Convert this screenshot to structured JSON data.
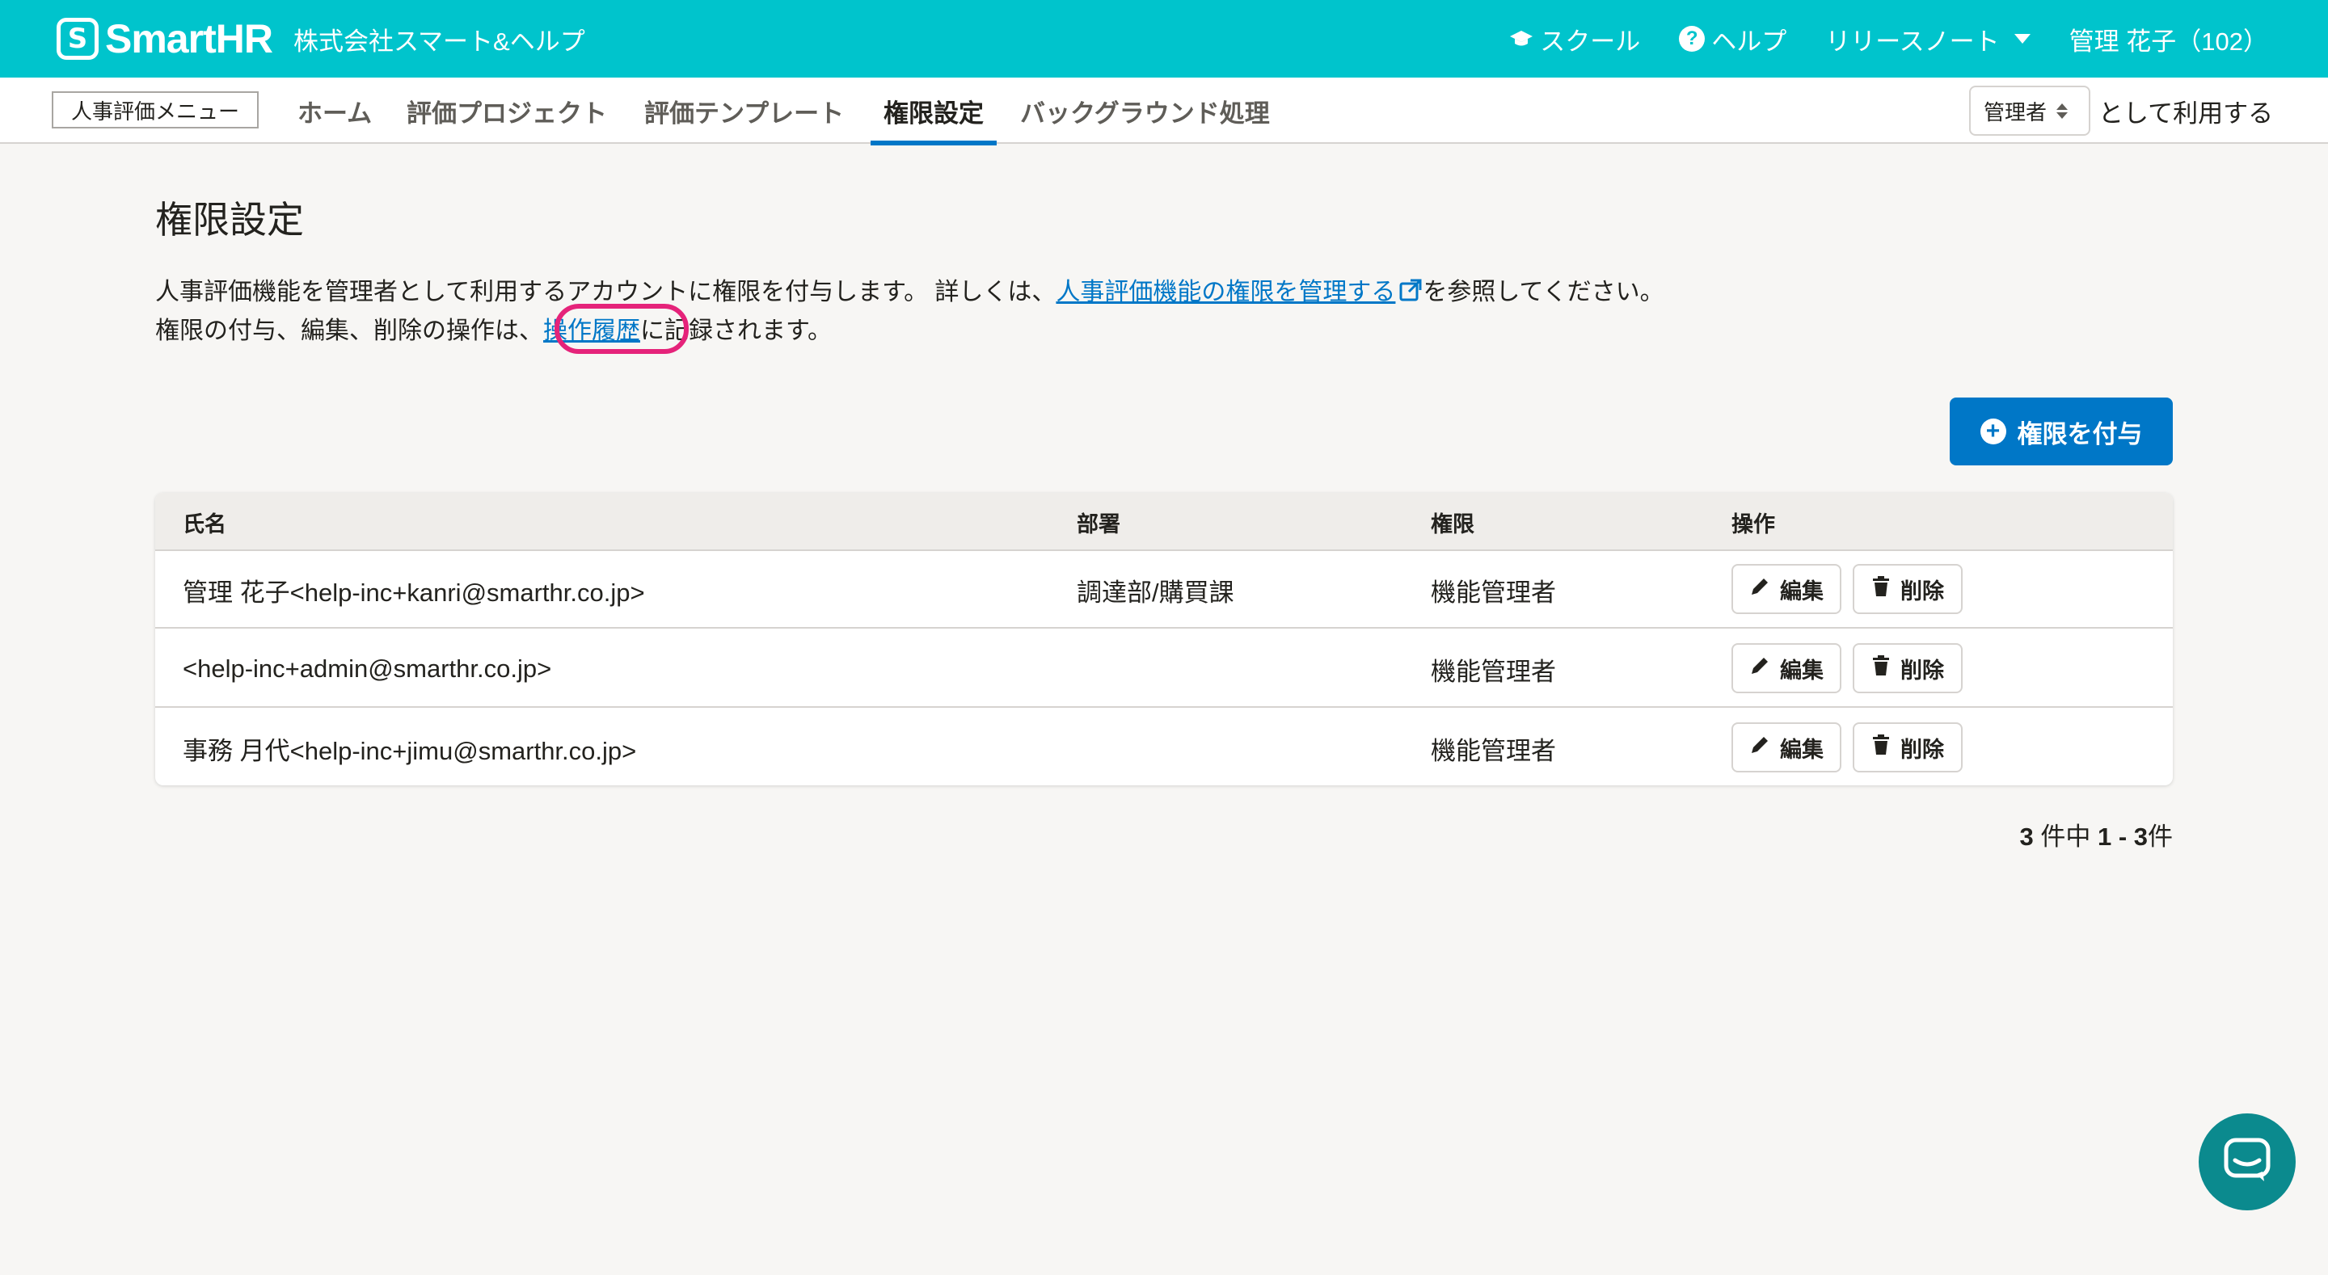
{
  "header": {
    "logo_text": "SmartHR",
    "logo_mark": "S",
    "company": "株式会社スマート&ヘルプ",
    "school": "スクール",
    "help": "ヘルプ",
    "release_notes": "リリースノート",
    "user": "管理 花子（102）",
    "brand_color": "#00c4cc"
  },
  "subnav": {
    "menu_label": "人事評価メニュー",
    "tabs": [
      {
        "label": "ホーム"
      },
      {
        "label": "評価プロジェクト"
      },
      {
        "label": "評価テンプレート"
      },
      {
        "label": "権限設定",
        "active": true
      },
      {
        "label": "バックグラウンド処理"
      }
    ],
    "role_select_value": "管理者",
    "role_suffix": "として利用する"
  },
  "main": {
    "title": "権限設定",
    "desc1_a": "人事評価機能を管理者として利用するアカウントに権限を付与します。 詳しくは、",
    "desc1_link": "人事評価機能の権限を管理する",
    "desc1_b": "を参照してください。",
    "desc2_a": "権限の付与、編集、削除の操作は、",
    "desc2_link": "操作履歴",
    "desc2_b": "に記録されます。",
    "grant_button": "権限を付与",
    "accent_color": "#0077c7"
  },
  "table": {
    "headers": [
      "氏名",
      "部署",
      "権限",
      "操作"
    ],
    "rows": [
      {
        "name": "管理 花子<help-inc+kanri@smarthr.co.jp>",
        "dept": "調達部/購買課",
        "perm": "機能管理者"
      },
      {
        "name": "<help-inc+admin@smarthr.co.jp>",
        "dept": "",
        "perm": "機能管理者"
      },
      {
        "name": "事務 月代<help-inc+jimu@smarthr.co.jp>",
        "dept": "",
        "perm": "機能管理者"
      }
    ],
    "edit_label": "編集",
    "delete_label": "削除"
  },
  "pager": {
    "total": "3",
    "total_suffix": " 件中 ",
    "range": "1 - 3",
    "range_suffix": "件"
  }
}
